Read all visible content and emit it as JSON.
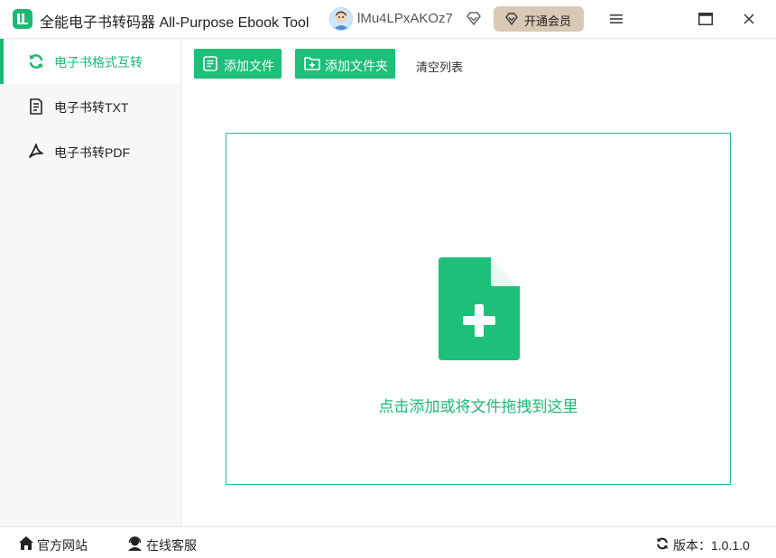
{
  "app": {
    "title": "全能电子书转码器 All-Purpose Ebook Tool"
  },
  "user": {
    "name": "lMu4LPxAKOz7",
    "vip_label": "开通会员"
  },
  "icons": {
    "app_logo": "book-icon",
    "vip": "diamond-icon",
    "minimize": "menu-icon",
    "maximize": "maximize-icon",
    "close": "close-icon"
  },
  "colors": {
    "accent": "#1db873",
    "vip_bg": "#d8c8b4"
  },
  "sidebar": {
    "items": [
      {
        "label": "电子书格式互转",
        "icon": "refresh-icon",
        "active": true
      },
      {
        "label": "电子书转TXT",
        "icon": "document-icon",
        "active": false
      },
      {
        "label": "电子书转PDF",
        "icon": "pdf-icon",
        "active": false
      }
    ]
  },
  "toolbar": {
    "add_file": "添加文件",
    "add_folder": "添加文件夹",
    "clear_list": "清空列表"
  },
  "dropzone": {
    "text": "点击添加或将文件拖拽到这里",
    "icon": "file-add-icon"
  },
  "footer": {
    "website": "官方网站",
    "support": "在线客服",
    "version": "版本：1.0.1.0"
  }
}
